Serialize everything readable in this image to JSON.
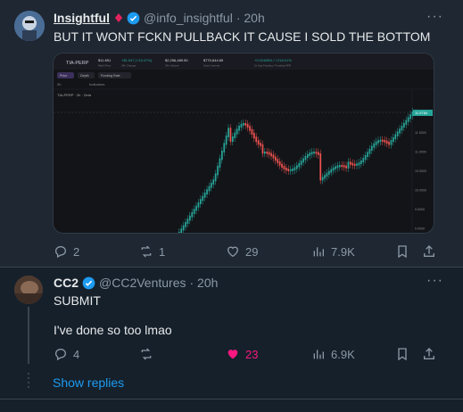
{
  "post1": {
    "display_name": "Insightful",
    "handle": "@info_insightful",
    "time": "· 20h",
    "more": "···",
    "text": "BUT IT WONT FCKN PULLBACK IT CAUSE I SOLD THE BOTTOM",
    "stats": {
      "replies": "2",
      "reposts": "1",
      "likes": "29",
      "views": "7.9K"
    }
  },
  "chart": {
    "ticker": "TIA-PERP",
    "stats": [
      {
        "value": "$11.851",
        "label": "Mark Price"
      },
      {
        "value": "+$1.547 (+15.47%)",
        "label": "24h Change"
      },
      {
        "value": "$2,256,489.50",
        "label": "24h Volume"
      },
      {
        "value": "$770,644.65",
        "label": "Open Interest"
      },
      {
        "value": "+0.02485% / +218.01%",
        "label": "1h Avg Funding / Funding APR"
      }
    ],
    "tabs": [
      "Price",
      "Depth",
      "Funding Rate"
    ],
    "toolbar_interval": "2h",
    "toolbar_indicators": "Indicators",
    "title": "TIA-PERP · 2h · Zeta",
    "price_label": "11.5784",
    "axis_ticks": [
      "11.5000",
      "11.0000",
      "10.5000",
      "10.0000",
      "9.5000",
      "9.0000",
      "8.5000"
    ],
    "colors": {
      "up": "#26a69a",
      "down": "#ef5350",
      "bg": "#131418"
    }
  },
  "post2": {
    "display_name": "CC2",
    "handle": "@CC2Ventures",
    "time": "· 20h",
    "more": "···",
    "text1": "SUBMIT",
    "text2": "I've done so too lmao",
    "stats": {
      "replies": "4",
      "reposts": "",
      "likes": "23",
      "views": "6.9K"
    }
  },
  "show_replies": "Show replies",
  "colors": {
    "accent": "#1d9bf0",
    "like": "#f91880",
    "bg": "#15202b"
  }
}
